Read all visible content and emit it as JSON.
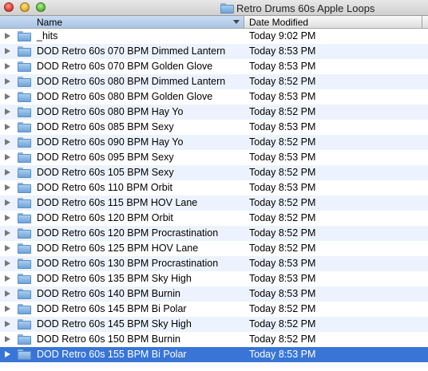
{
  "window": {
    "title": "Retro Drums 60s Apple Loops",
    "title_icon": "folder-icon"
  },
  "columns": {
    "name": "Name",
    "date_modified": "Date Modified"
  },
  "items": [
    {
      "name": "_hits",
      "date": "Today 9:02 PM"
    },
    {
      "name": "DOD Retro 60s 070 BPM Dimmed Lantern",
      "date": "Today 8:53 PM"
    },
    {
      "name": "DOD Retro 60s 070 BPM Golden Glove",
      "date": "Today 8:53 PM"
    },
    {
      "name": "DOD Retro 60s 080 BPM Dimmed Lantern",
      "date": "Today 8:52 PM"
    },
    {
      "name": "DOD Retro 60s 080 BPM Golden Glove",
      "date": "Today 8:53 PM"
    },
    {
      "name": "DOD Retro 60s 080 BPM Hay Yo",
      "date": "Today 8:52 PM"
    },
    {
      "name": "DOD Retro 60s 085 BPM Sexy",
      "date": "Today 8:53 PM"
    },
    {
      "name": "DOD Retro 60s 090 BPM Hay Yo",
      "date": "Today 8:52 PM"
    },
    {
      "name": "DOD Retro 60s 095 BPM Sexy",
      "date": "Today 8:53 PM"
    },
    {
      "name": "DOD Retro 60s 105 BPM Sexy",
      "date": "Today 8:52 PM"
    },
    {
      "name": "DOD Retro 60s 110 BPM Orbit",
      "date": "Today 8:53 PM"
    },
    {
      "name": "DOD Retro 60s 115 BPM HOV Lane",
      "date": "Today 8:52 PM"
    },
    {
      "name": "DOD Retro 60s 120 BPM Orbit",
      "date": "Today 8:52 PM"
    },
    {
      "name": "DOD Retro 60s 120 BPM Procrastination",
      "date": "Today 8:52 PM"
    },
    {
      "name": "DOD Retro 60s 125 BPM HOV Lane",
      "date": "Today 8:52 PM"
    },
    {
      "name": "DOD Retro 60s 130 BPM Procrastination",
      "date": "Today 8:53 PM"
    },
    {
      "name": "DOD Retro 60s 135 BPM Sky High",
      "date": "Today 8:53 PM"
    },
    {
      "name": "DOD Retro 60s 140 BPM Burnin",
      "date": "Today 8:53 PM"
    },
    {
      "name": "DOD Retro 60s 145 BPM Bi Polar",
      "date": "Today 8:52 PM"
    },
    {
      "name": "DOD Retro 60s 145 BPM Sky High",
      "date": "Today 8:52 PM"
    },
    {
      "name": "DOD Retro 60s 150 BPM Burnin",
      "date": "Today 8:52 PM"
    },
    {
      "name": "DOD Retro 60s 155 BPM Bi Polar",
      "date": "Today 8:53 PM",
      "selected": true
    }
  ],
  "colors": {
    "selection": "#3875d7",
    "alternate_row": "#edf3fe",
    "folder": "#8fbbe6"
  }
}
